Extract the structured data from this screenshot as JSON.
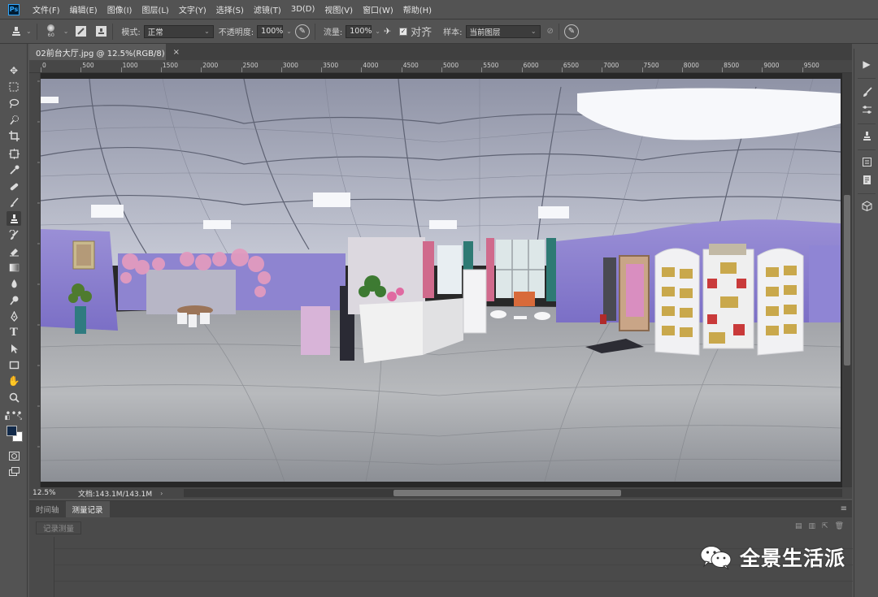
{
  "app": {
    "logo": "Ps"
  },
  "menu": [
    "文件(F)",
    "编辑(E)",
    "图像(I)",
    "图层(L)",
    "文字(Y)",
    "选择(S)",
    "滤镜(T)",
    "3D(D)",
    "视图(V)",
    "窗口(W)",
    "帮助(H)"
  ],
  "options": {
    "brush_size": "60",
    "mode_label": "模式:",
    "mode_value": "正常",
    "opacity_label": "不透明度:",
    "opacity_value": "100%",
    "flow_label": "流量:",
    "flow_value": "100%",
    "aligned_label": "对齐",
    "aligned_checked": true,
    "sample_label": "样本:",
    "sample_value": "当前图层"
  },
  "document": {
    "tab_title": "02前台大厅.jpg @ 12.5%(RGB/8)",
    "close_glyph": "×"
  },
  "ruler": {
    "h_labels": [
      "0",
      "500",
      "1000",
      "1500",
      "2000",
      "2500",
      "3000",
      "3500",
      "4000",
      "4500",
      "5000",
      "5500",
      "6000",
      "6500",
      "7000",
      "7500",
      "8000",
      "8500",
      "9000",
      "9500"
    ]
  },
  "status": {
    "zoom": "12.5%",
    "doc_size": "文档:143.1M/143.1M",
    "arrow": "›"
  },
  "panel": {
    "tabs": [
      "时间轴",
      "测量记录"
    ],
    "active_tab": "测量记录",
    "record_button": "记录测量",
    "menu_glyph": "≡"
  },
  "watermark": {
    "text": "全景生活派"
  },
  "colors": {
    "foreground": "#122a4a",
    "background": "#ffffff",
    "ps_blue": "#31a8ff"
  },
  "tools": [
    "move-icon",
    "marquee-icon",
    "lasso-icon",
    "quick-select-icon",
    "crop-icon",
    "frame-icon",
    "eyedropper-icon",
    "healing-brush-icon",
    "brush-icon",
    "clone-stamp-icon",
    "history-brush-icon",
    "eraser-icon",
    "gradient-icon",
    "blur-icon",
    "dodge-icon",
    "pen-icon",
    "type-icon",
    "path-select-icon",
    "rectangle-icon",
    "hand-icon",
    "zoom-icon",
    "more-tools-icon",
    "quick-mask-icon",
    "screen-mode-icon"
  ]
}
